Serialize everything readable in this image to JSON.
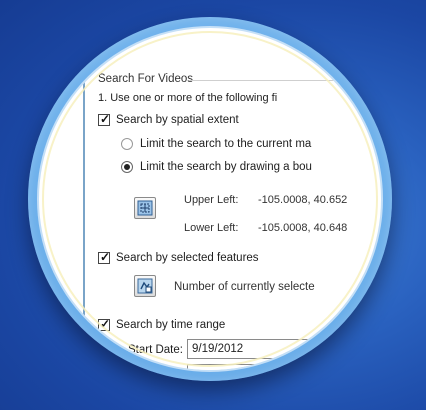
{
  "search_group": {
    "title": "Search For Videos",
    "instruction": "1. Use one or more of the following fi"
  },
  "spatial": {
    "label": "Search by spatial extent",
    "checked": true,
    "option_current_map": "Limit the search to the current ma",
    "option_draw_bounds": "Limit the search by drawing a bou",
    "selected_option": "draw_bounds",
    "upper_left_label": "Upper Left:",
    "upper_left_value": "-105.0008, 40.652",
    "lower_left_label": "Lower Left:",
    "lower_left_value": "-105.0008, 40.648",
    "draw_tool_icon": "draw-extent-icon"
  },
  "features": {
    "label": "Search by selected features",
    "checked": true,
    "count_label": "Number of currently selecte",
    "select_tool_icon": "select-features-icon"
  },
  "time": {
    "label": "Search by time range",
    "checked": true,
    "start_date_label": "Start Date:",
    "start_date_value": "9/19/2012"
  },
  "colors": {
    "background": "#1b47a4",
    "bezel": "#6aaeea",
    "rim": "#f7f0be"
  }
}
